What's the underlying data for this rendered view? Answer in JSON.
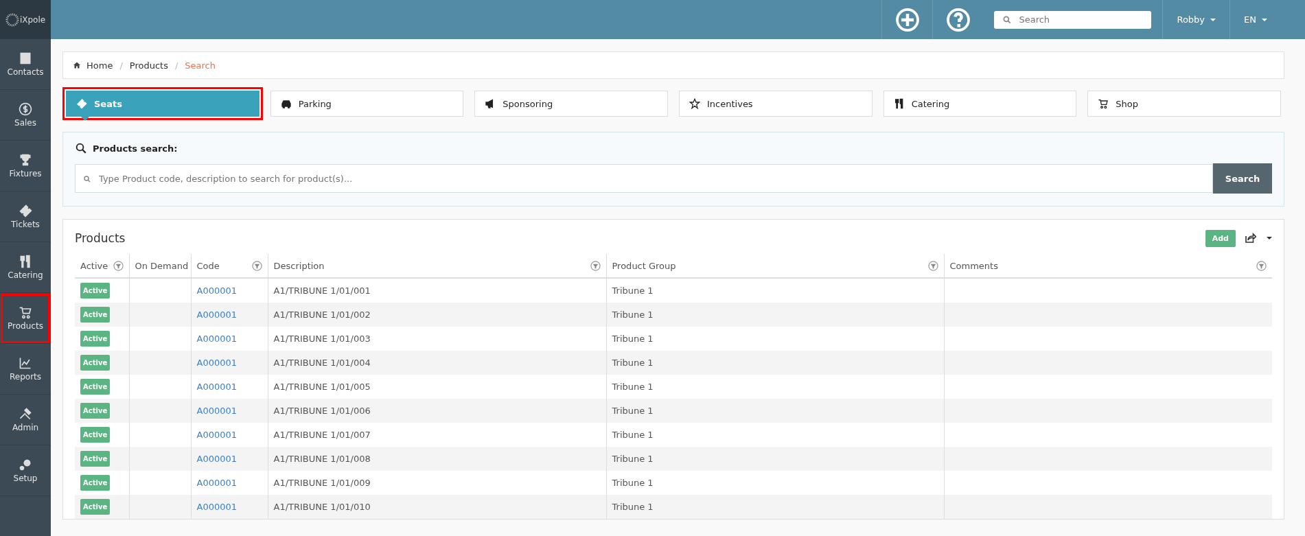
{
  "sidebar": {
    "logo": "iXpole",
    "items": [
      {
        "label": "Contacts",
        "highlighted": false
      },
      {
        "label": "Sales",
        "highlighted": false
      },
      {
        "label": "Fixtures",
        "highlighted": false
      },
      {
        "label": "Tickets",
        "highlighted": false
      },
      {
        "label": "Catering",
        "highlighted": false
      },
      {
        "label": "Products",
        "highlighted": true
      },
      {
        "label": "Reports",
        "highlighted": false
      },
      {
        "label": "Admin",
        "highlighted": false
      },
      {
        "label": "Setup",
        "highlighted": false
      }
    ]
  },
  "topbar": {
    "search": {
      "placeholder": "Search"
    },
    "user": "Robby",
    "language": "EN"
  },
  "breadcrumb": [
    {
      "kind": "link",
      "text": "Home"
    },
    {
      "kind": "separator",
      "text": "/"
    },
    {
      "kind": "link",
      "text": "Products"
    },
    {
      "kind": "separator",
      "text": "/"
    },
    {
      "kind": "current",
      "text": "Search"
    }
  ],
  "tabs": [
    {
      "label": "Seats",
      "selected": true,
      "highlighted": true
    },
    {
      "label": "Parking",
      "selected": false,
      "highlighted": false
    },
    {
      "label": "Sponsoring",
      "selected": false,
      "highlighted": false
    },
    {
      "label": "Incentives",
      "selected": false,
      "highlighted": false
    },
    {
      "label": "Catering",
      "selected": false,
      "highlighted": false
    },
    {
      "label": "Shop",
      "selected": false,
      "highlighted": false
    }
  ],
  "products_search": {
    "title": "Products search:",
    "placeholder": "Type Product code, description to search for product(s)...",
    "button": "Search"
  },
  "products": {
    "title": "Products",
    "add_button": "Add",
    "columns": [
      "Active",
      "On Demand",
      "Code",
      "Description",
      "Product Group",
      "Comments"
    ],
    "rows": [
      {
        "status": "Active",
        "on_demand": "",
        "code": "A000001",
        "description": "A1/TRIBUNE 1/01/001",
        "group": "Tribune 1",
        "comments": ""
      },
      {
        "status": "Active",
        "on_demand": "",
        "code": "A000001",
        "description": "A1/TRIBUNE 1/01/002",
        "group": "Tribune 1",
        "comments": ""
      },
      {
        "status": "Active",
        "on_demand": "",
        "code": "A000001",
        "description": "A1/TRIBUNE 1/01/003",
        "group": "Tribune 1",
        "comments": ""
      },
      {
        "status": "Active",
        "on_demand": "",
        "code": "A000001",
        "description": "A1/TRIBUNE 1/01/004",
        "group": "Tribune 1",
        "comments": ""
      },
      {
        "status": "Active",
        "on_demand": "",
        "code": "A000001",
        "description": "A1/TRIBUNE 1/01/005",
        "group": "Tribune 1",
        "comments": ""
      },
      {
        "status": "Active",
        "on_demand": "",
        "code": "A000001",
        "description": "A1/TRIBUNE 1/01/006",
        "group": "Tribune 1",
        "comments": ""
      },
      {
        "status": "Active",
        "on_demand": "",
        "code": "A000001",
        "description": "A1/TRIBUNE 1/01/007",
        "group": "Tribune 1",
        "comments": ""
      },
      {
        "status": "Active",
        "on_demand": "",
        "code": "A000001",
        "description": "A1/TRIBUNE 1/01/008",
        "group": "Tribune 1",
        "comments": ""
      },
      {
        "status": "Active",
        "on_demand": "",
        "code": "A000001",
        "description": "A1/TRIBUNE 1/01/009",
        "group": "Tribune 1",
        "comments": ""
      },
      {
        "status": "Active",
        "on_demand": "",
        "code": "A000001",
        "description": "A1/TRIBUNE 1/01/010",
        "group": "Tribune 1",
        "comments": ""
      }
    ]
  }
}
